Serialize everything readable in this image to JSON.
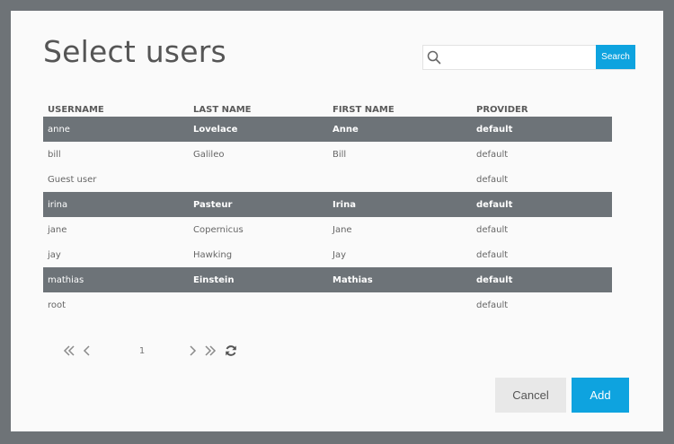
{
  "dialog": {
    "title": "Select users",
    "search": {
      "placeholder": "",
      "value": "",
      "button_label": "Search"
    },
    "table": {
      "columns": [
        "USERNAME",
        "LAST NAME",
        "FIRST NAME",
        "PROVIDER"
      ],
      "rows": [
        {
          "username": "anne",
          "last_name": "Lovelace",
          "first_name": "Anne",
          "provider": "default",
          "selected": true
        },
        {
          "username": "bill",
          "last_name": "Galileo",
          "first_name": "Bill",
          "provider": "default",
          "selected": false
        },
        {
          "username": "Guest user",
          "last_name": "",
          "first_name": "",
          "provider": "default",
          "selected": false
        },
        {
          "username": "irina",
          "last_name": "Pasteur",
          "first_name": "Irina",
          "provider": "default",
          "selected": true
        },
        {
          "username": "jane",
          "last_name": "Copernicus",
          "first_name": "Jane",
          "provider": "default",
          "selected": false
        },
        {
          "username": "jay",
          "last_name": "Hawking",
          "first_name": "Jay",
          "provider": "default",
          "selected": false
        },
        {
          "username": "mathias",
          "last_name": "Einstein",
          "first_name": "Mathias",
          "provider": "default",
          "selected": true
        },
        {
          "username": "root",
          "last_name": "",
          "first_name": "",
          "provider": "default",
          "selected": false
        }
      ]
    },
    "pagination": {
      "current_page": "1",
      "icons": [
        "first-page-icon",
        "previous-page-icon",
        "next-page-icon",
        "last-page-icon",
        "refresh-icon"
      ]
    },
    "buttons": {
      "cancel": "Cancel",
      "add": "Add"
    },
    "colors": {
      "accent": "#0ea3df",
      "selected_row": "#6d7378",
      "backdrop": "#6e7377"
    }
  }
}
